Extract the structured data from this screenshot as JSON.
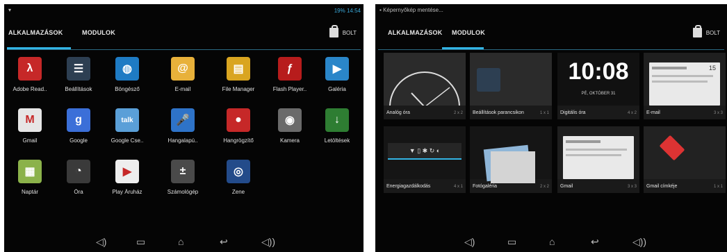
{
  "left": {
    "status": {
      "icon": "notification-icon",
      "battery": "19%",
      "time": "14:54"
    },
    "tabs": {
      "apps": "ALKALMAZÁSOK",
      "widgets": "MODULOK"
    },
    "store_label": "BOLT",
    "apps": [
      {
        "label": "Adobe Read..",
        "icon": "adobe-reader-icon",
        "color": "#c62828",
        "glyph": "λ"
      },
      {
        "label": "Beállítások",
        "icon": "settings-icon",
        "color": "#2d3f52",
        "glyph": "☰"
      },
      {
        "label": "Böngésző",
        "icon": "browser-icon",
        "color": "#1e7bc4",
        "glyph": "◍"
      },
      {
        "label": "E-mail",
        "icon": "email-icon",
        "color": "#e8b13a",
        "glyph": "@"
      },
      {
        "label": "File Manager",
        "icon": "file-manager-icon",
        "color": "#d9a520",
        "glyph": "▤"
      },
      {
        "label": "Flash Player..",
        "icon": "flash-player-icon",
        "color": "#b71c1c",
        "glyph": "ƒ"
      },
      {
        "label": "Galéria",
        "icon": "gallery-icon",
        "color": "#2a86c9",
        "glyph": "▶"
      },
      {
        "label": "Gmail",
        "icon": "gmail-icon",
        "color": "#e6e6e6",
        "glyph": "M"
      },
      {
        "label": "Google",
        "icon": "google-search-icon",
        "color": "#3b6fd8",
        "glyph": "g"
      },
      {
        "label": "Google Cse..",
        "icon": "google-talk-icon",
        "color": "#5a9fd8",
        "glyph": "talk"
      },
      {
        "label": "Hangalapú..",
        "icon": "voice-search-icon",
        "color": "#2e73c8",
        "glyph": "🎤"
      },
      {
        "label": "Hangrögzítő",
        "icon": "sound-recorder-icon",
        "color": "#c62828",
        "glyph": "●"
      },
      {
        "label": "Kamera",
        "icon": "camera-icon",
        "color": "#6a6a6a",
        "glyph": "◉"
      },
      {
        "label": "Letöltések",
        "icon": "downloads-icon",
        "color": "#2e7d32",
        "glyph": "↓"
      },
      {
        "label": "Naptár",
        "icon": "calendar-icon",
        "color": "#8bb24a",
        "glyph": "▦"
      },
      {
        "label": "Óra",
        "icon": "clock-icon",
        "color": "#3a3a3a",
        "glyph": "◔"
      },
      {
        "label": "Play Áruház",
        "icon": "play-store-icon",
        "color": "#eeeeee",
        "glyph": "▶"
      },
      {
        "label": "Számológép",
        "icon": "calculator-icon",
        "color": "#4a4a4a",
        "glyph": "±"
      },
      {
        "label": "Zene",
        "icon": "music-icon",
        "color": "#234b8a",
        "glyph": "◎"
      }
    ],
    "nav": [
      "volume-down-icon",
      "recent-apps-icon",
      "home-icon",
      "back-icon",
      "volume-up-icon"
    ]
  },
  "right": {
    "status": {
      "icon": "screenshot-icon",
      "text": "Képernyőkép mentése..."
    },
    "tabs": {
      "apps": "ALKALMAZÁSOK",
      "widgets": "MODULOK"
    },
    "store_label": "BOLT",
    "widgets": [
      {
        "label": "Analóg óra",
        "size": "2 x 2",
        "preview": "analog-clock-preview"
      },
      {
        "label": "Beállítások parancsikon",
        "size": "1 x 1",
        "preview": "settings-shortcut-preview"
      },
      {
        "label": "Digitális óra",
        "size": "4 x 2",
        "preview": "digital-clock-preview",
        "time": "10:08",
        "date": "PÉ, OKTÓBER 31"
      },
      {
        "label": "E-mail",
        "size": "3 x 3",
        "preview": "email-widget-preview",
        "badge": "15"
      },
      {
        "label": "Energiagazdálkodás",
        "size": "4 x 1",
        "preview": "power-control-preview"
      },
      {
        "label": "Fotógaléria",
        "size": "2 x 2",
        "preview": "photo-gallery-preview"
      },
      {
        "label": "Gmail",
        "size": "3 x 3",
        "preview": "gmail-widget-preview"
      },
      {
        "label": "Gmail címkéje",
        "size": "1 x 1",
        "preview": "gmail-label-preview"
      }
    ],
    "nav": [
      "volume-down-icon",
      "recent-apps-icon",
      "home-icon",
      "back-icon",
      "volume-up-icon"
    ]
  }
}
